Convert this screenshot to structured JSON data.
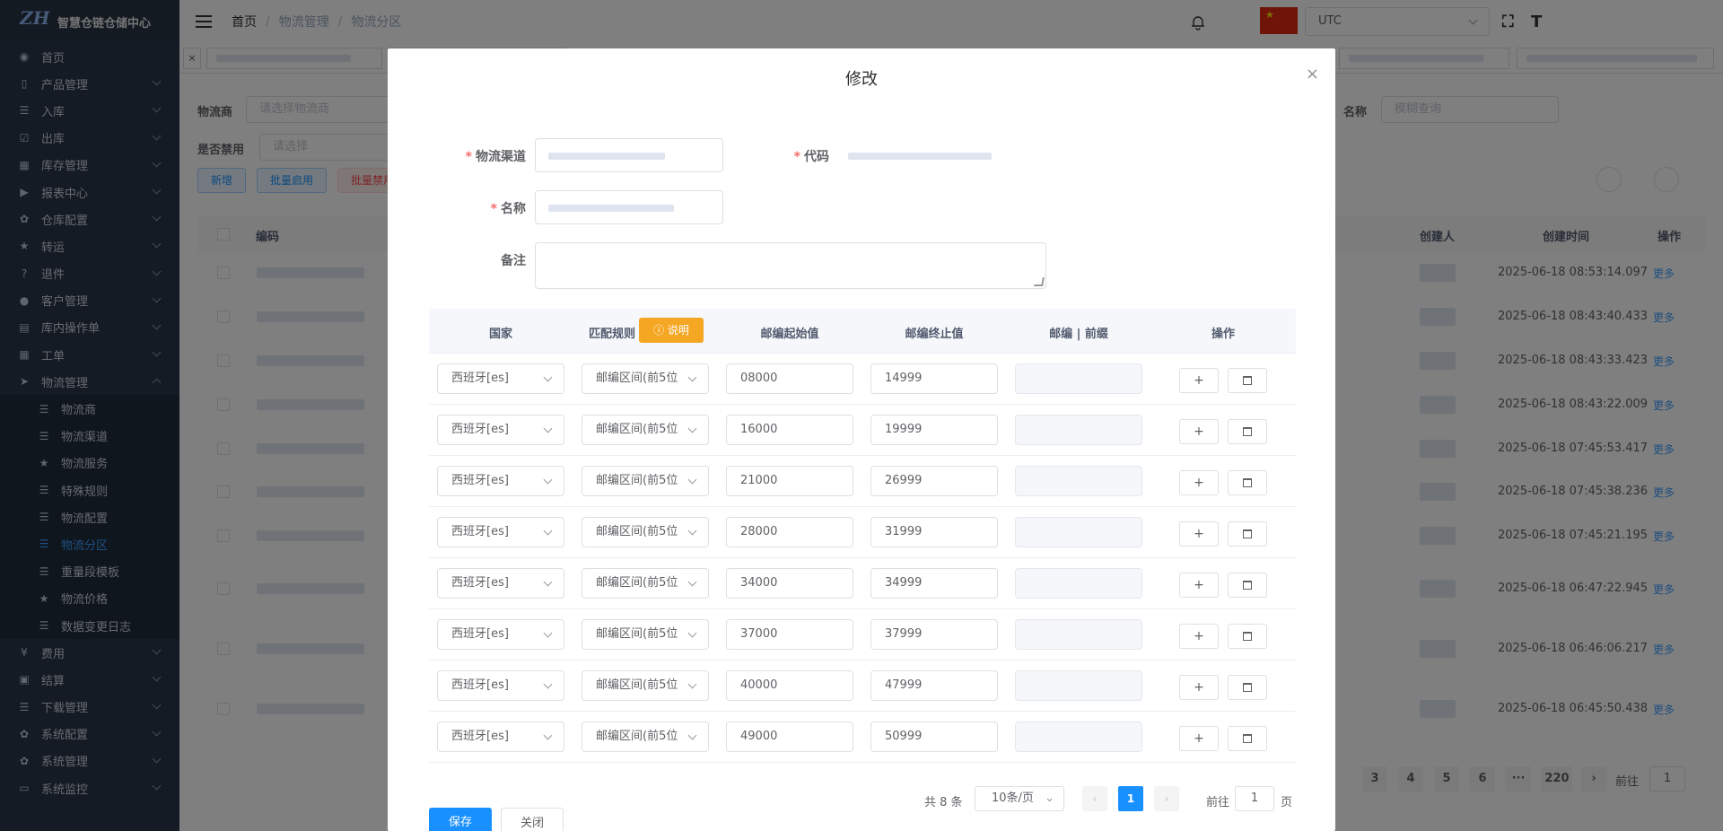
{
  "app": {
    "title": "智慧仓链仓储中心",
    "logo_text": "ZH"
  },
  "sidebar": {
    "items": [
      {
        "label": "首页",
        "icon": "dashboard-icon"
      },
      {
        "label": "产品管理",
        "icon": "phone-icon"
      },
      {
        "label": "入库",
        "icon": "list-icon"
      },
      {
        "label": "出库",
        "icon": "checkbox-icon"
      },
      {
        "label": "库存管理",
        "icon": "inventory-icon"
      },
      {
        "label": "报表中心",
        "icon": "video-icon"
      },
      {
        "label": "仓库配置",
        "icon": "gear-icon"
      },
      {
        "label": "转运",
        "icon": "star-icon"
      },
      {
        "label": "退件",
        "icon": "question-icon"
      },
      {
        "label": "客户管理",
        "icon": "user-icon"
      },
      {
        "label": "库内操作单",
        "icon": "document-icon"
      },
      {
        "label": "工单",
        "icon": "grid-icon"
      },
      {
        "label": "物流管理",
        "icon": "send-icon"
      }
    ],
    "submenu": [
      {
        "label": "物流商",
        "icon": "list-icon"
      },
      {
        "label": "物流渠道",
        "icon": "list-icon"
      },
      {
        "label": "物流服务",
        "icon": "star-icon"
      },
      {
        "label": "特殊规则",
        "icon": "list-icon"
      },
      {
        "label": "物流配置",
        "icon": "list-icon"
      },
      {
        "label": "物流分区",
        "icon": "list-icon"
      },
      {
        "label": "重量段模板",
        "icon": "list-icon"
      },
      {
        "label": "物流价格",
        "icon": "star-icon"
      },
      {
        "label": "数据变更日志",
        "icon": "list-icon"
      }
    ],
    "bottom_items": [
      {
        "label": "费用",
        "icon": "money-icon"
      },
      {
        "label": "结算",
        "icon": "calculator-icon"
      },
      {
        "label": "下载管理",
        "icon": "list-icon"
      },
      {
        "label": "系统配置",
        "icon": "gear-icon"
      },
      {
        "label": "系统管理",
        "icon": "gear-icon"
      },
      {
        "label": "系统监控",
        "icon": "monitor-icon"
      }
    ]
  },
  "header": {
    "breadcrumb": [
      "首页",
      "物流管理",
      "物流分区"
    ],
    "timezone": "UTC",
    "flag_color": "#de2910"
  },
  "filters": {
    "carrier_label": "物流商",
    "carrier_placeholder": "请选择物流商",
    "name_label": "名称",
    "name_placeholder": "模糊查询",
    "disabled_label": "是否禁用",
    "disabled_placeholder": "请选择"
  },
  "toolbar": {
    "add": "新增",
    "batch_enable": "批量启用",
    "batch_disable": "批量禁用"
  },
  "table": {
    "headers": {
      "code": "编码",
      "creator": "创建人",
      "created_time": "创建时间",
      "action": "操作"
    },
    "rows": [
      {
        "time": "2025-06-18 08:53:14.097",
        "more": "更多"
      },
      {
        "time": "2025-06-18 08:43:40.433",
        "more": "更多"
      },
      {
        "time": "2025-06-18 08:43:33.423",
        "more": "更多"
      },
      {
        "time": "2025-06-18 08:43:22.009",
        "more": "更多"
      },
      {
        "time": "2025-06-18 07:45:53.417",
        "more": "更多"
      },
      {
        "time": "2025-06-18 07:45:38.236",
        "more": "更多"
      },
      {
        "time": "2025-06-18 07:45:21.195",
        "more": "更多"
      },
      {
        "time": "2025-06-18 06:47:22.945",
        "more": "更多"
      },
      {
        "time": "2025-06-18 06:46:06.217",
        "more": "更多"
      },
      {
        "time": "2025-06-18 06:45:50.438",
        "more": "更多"
      }
    ],
    "pages": [
      "3",
      "4",
      "5",
      "6",
      "···",
      "220"
    ],
    "goto_label": "前往",
    "goto_value": "1"
  },
  "modal": {
    "title": "修改",
    "fields": {
      "channel": "物流渠道",
      "code": "代码",
      "name": "名称",
      "remark": "备注"
    },
    "columns": {
      "country": "国家",
      "rule": "匹配规则",
      "rule_badge": "说明",
      "start": "邮编起始值",
      "end": "邮编终止值",
      "prefix": "邮编 | 前缀",
      "action": "操作"
    },
    "rows": [
      {
        "country": "西班牙[es]",
        "rule": "邮编区间(前5位",
        "start": "08000",
        "end": "14999"
      },
      {
        "country": "西班牙[es]",
        "rule": "邮编区间(前5位",
        "start": "16000",
        "end": "19999"
      },
      {
        "country": "西班牙[es]",
        "rule": "邮编区间(前5位",
        "start": "21000",
        "end": "26999"
      },
      {
        "country": "西班牙[es]",
        "rule": "邮编区间(前5位",
        "start": "28000",
        "end": "31999"
      },
      {
        "country": "西班牙[es]",
        "rule": "邮编区间(前5位",
        "start": "34000",
        "end": "34999"
      },
      {
        "country": "西班牙[es]",
        "rule": "邮编区间(前5位",
        "start": "37000",
        "end": "37999"
      },
      {
        "country": "西班牙[es]",
        "rule": "邮编区间(前5位",
        "start": "40000",
        "end": "47999"
      },
      {
        "country": "西班牙[es]",
        "rule": "邮编区间(前5位",
        "start": "49000",
        "end": "50999"
      }
    ],
    "pager": {
      "total": "共 8 条",
      "page_size": "10条/页",
      "current": "1",
      "goto_label": "前往",
      "goto_value": "1",
      "page_suffix": "页"
    },
    "save": "保存",
    "close": "关闭"
  },
  "colors": {
    "accent": "#409eff",
    "badge": "#f5a623",
    "sidebar": "#2b3648"
  }
}
